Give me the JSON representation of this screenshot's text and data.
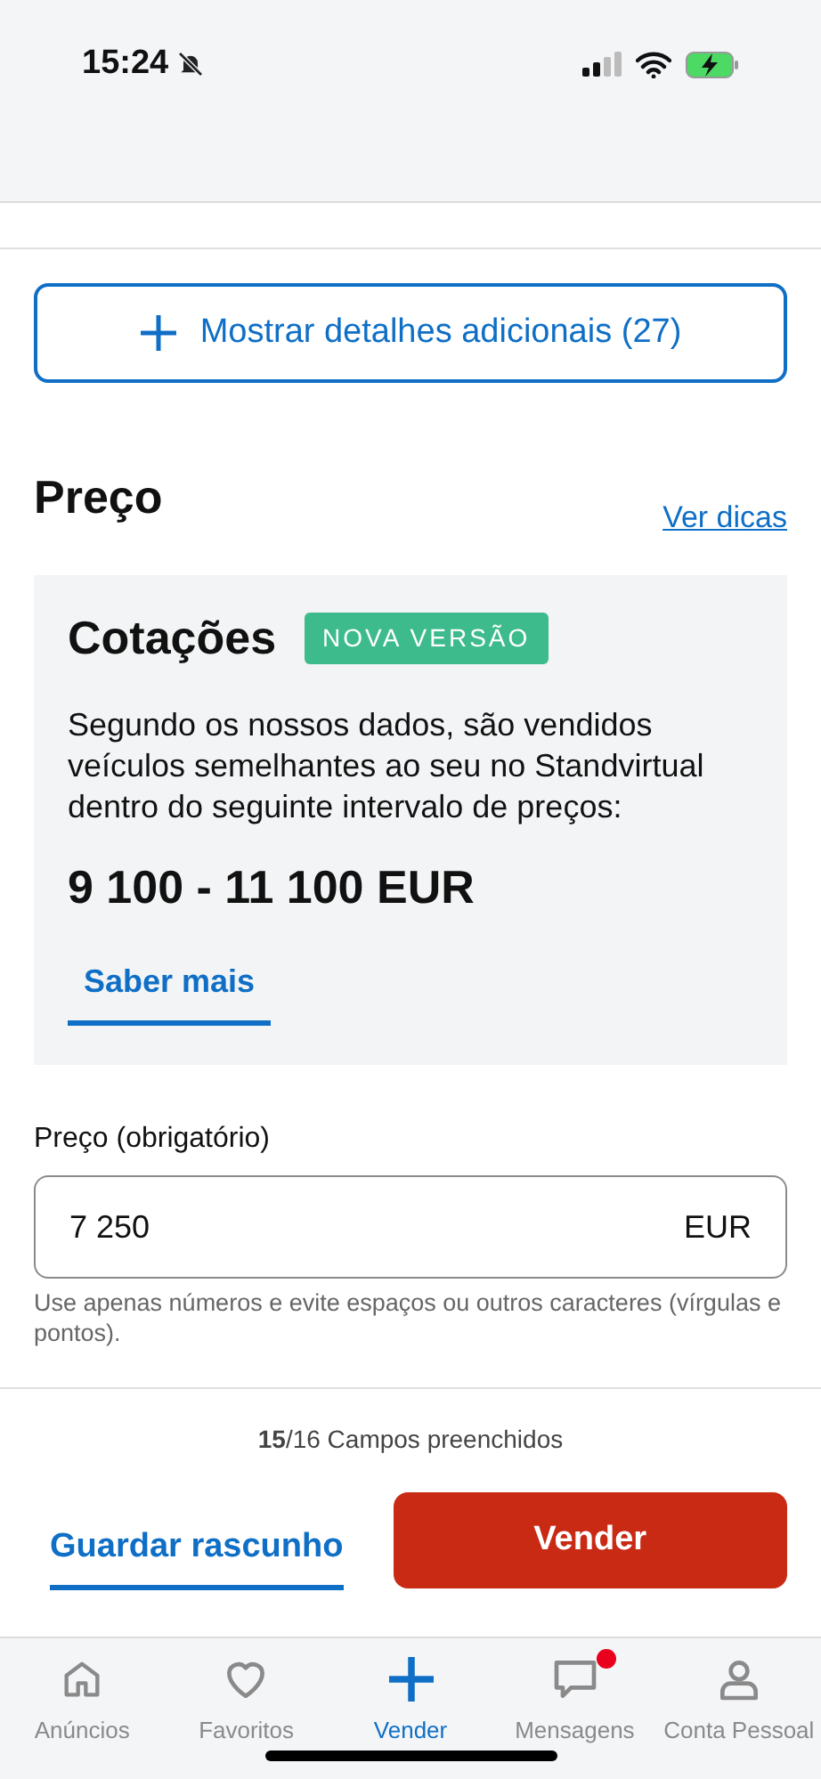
{
  "status_bar": {
    "time": "15:24",
    "silent": true
  },
  "details_button": {
    "label": "Mostrar detalhes adicionais (27)"
  },
  "price_section": {
    "title": "Preço",
    "tips_link": "Ver dicas"
  },
  "quotes_card": {
    "title": "Cotações",
    "badge": "NOVA VERSÃO",
    "description": "Segundo os nossos dados, são vendidos veículos semelhantes ao seu no Standvirtual dentro do seguinte intervalo de preços:",
    "range": "9 100 - 11 100 EUR",
    "link": "Saber mais"
  },
  "price_field": {
    "label": "Preço (obrigatório)",
    "value": "7 250",
    "unit": "EUR",
    "hint": "Use apenas números e evite espaços ou outros caracteres (vírgulas e pontos)."
  },
  "progress": {
    "text": "**15**/16 Campos preenchidos"
  },
  "actions": {
    "draft": "Guardar rascunho",
    "sell": "Vender"
  },
  "tabs": [
    {
      "kind": "home",
      "label": "Anúncios",
      "selected": false,
      "notification": false
    },
    {
      "kind": "heart",
      "label": "Favoritos",
      "selected": false,
      "notification": false
    },
    {
      "kind": "plus",
      "label": "Vender",
      "selected": true,
      "notification": false
    },
    {
      "kind": "chat",
      "label": "Mensagens",
      "selected": false,
      "notification": true
    },
    {
      "kind": "user",
      "label": "Conta Pessoal",
      "selected": false,
      "notification": false
    }
  ]
}
